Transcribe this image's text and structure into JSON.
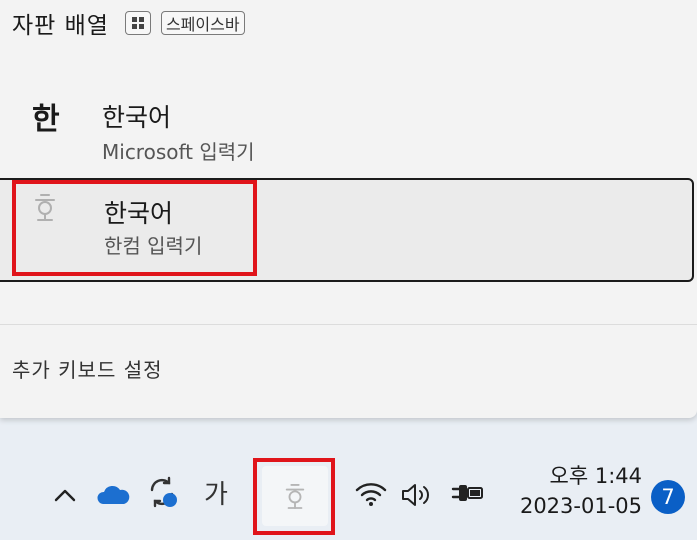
{
  "flyout": {
    "title": "자판 배열",
    "shortcut_win_key": "windows-logo-key",
    "shortcut_space_label": "스페이스바",
    "items": [
      {
        "glyph": "한",
        "name": "한국어",
        "sub": "Microsoft 입력기",
        "icon": "korean-han-glyph"
      },
      {
        "glyph_icon": "hanword-ime-icon",
        "name": "한국어",
        "sub": "한컴 입력기",
        "selected": true
      }
    ],
    "more_settings": "추가 키보드 설정"
  },
  "taskbar": {
    "tray_icons": [
      "chevron-up-icon",
      "onedrive-icon",
      "sync-icon",
      "ime-ga-icon",
      "hanword-ime-icon",
      "wifi-icon",
      "volume-icon",
      "power-plug-icon"
    ],
    "ime_label": "가",
    "clock_time": "오후 1:44",
    "clock_date": "2023-01-05",
    "notification_count": "7"
  },
  "colors": {
    "highlight": "#e0141a",
    "accent": "#0a5fc6",
    "onedrive": "#1c6fd0"
  }
}
